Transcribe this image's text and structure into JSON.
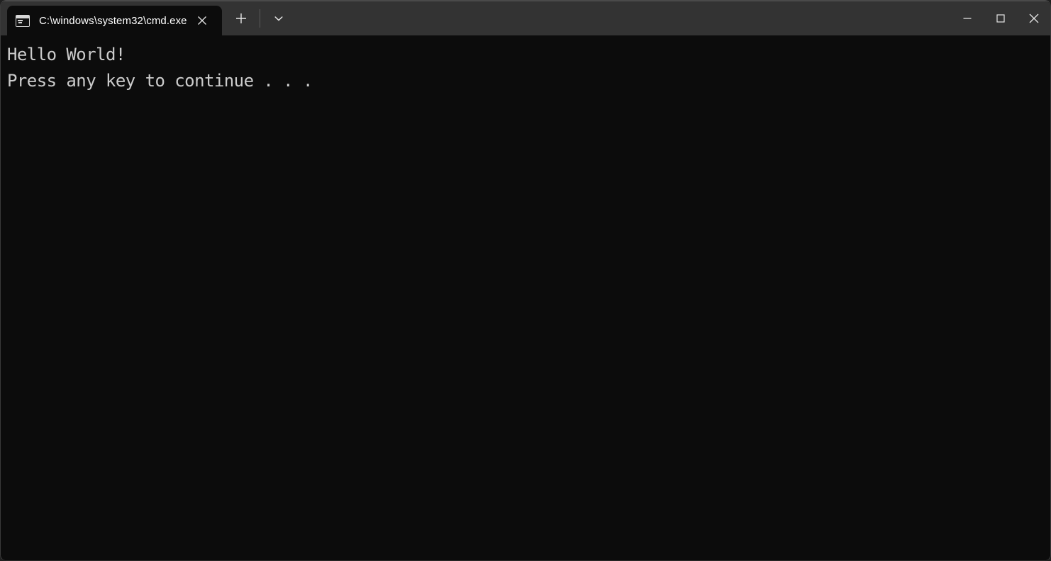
{
  "window": {
    "background_color": "#0c0c0c",
    "titlebar_color": "#333333",
    "border_color": "#3a3a3a"
  },
  "titlebar": {
    "tabs": [
      {
        "title": "C:\\windows\\system32\\cmd.exe",
        "icon": "console-icon",
        "active": true,
        "close_label": "✕"
      }
    ],
    "new_tab_label": "+",
    "dropdown_label": "⌄",
    "controls": {
      "minimize_label": "─",
      "maximize_label": "□",
      "close_label": "✕"
    }
  },
  "terminal": {
    "foreground_color": "#cccccc",
    "background_color": "#0c0c0c",
    "lines": [
      "Hello World!",
      "Press any key to continue . . ."
    ]
  }
}
